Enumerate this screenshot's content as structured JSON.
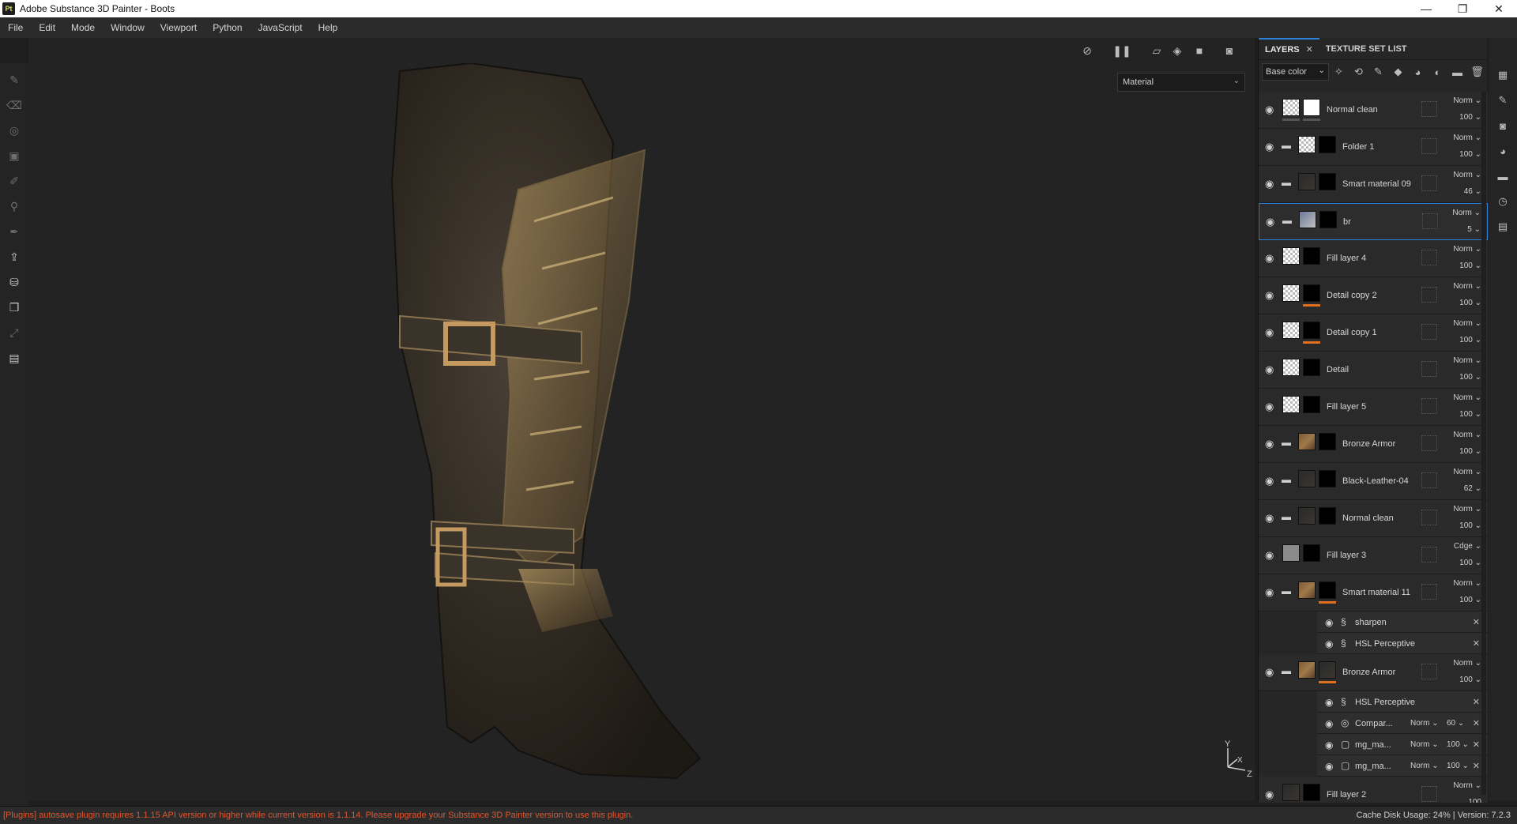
{
  "window": {
    "app_logo": "Pt",
    "title": "Adobe Substance 3D Painter - Boots",
    "controls": {
      "minimize": "—",
      "maximize": "❐",
      "close": "✕"
    }
  },
  "menu": [
    "File",
    "Edit",
    "Mode",
    "Window",
    "Viewport",
    "Python",
    "JavaScript",
    "Help"
  ],
  "viewport": {
    "material_mode": "Material",
    "axis": {
      "y": "Y",
      "x": "X",
      "z": "Z"
    }
  },
  "panel": {
    "tabs": [
      {
        "label": "LAYERS",
        "close": "✕"
      },
      {
        "label": "TEXTURE SET LIST"
      }
    ],
    "channel": "Base color",
    "layers": [
      {
        "name": "Normal clean",
        "blend": "Norm ⌄",
        "opacity": "100 ⌄"
      },
      {
        "name": "Folder 1",
        "blend": "Norm ⌄",
        "opacity": "100 ⌄"
      },
      {
        "name": "Smart material 09",
        "blend": "Norm ⌄",
        "opacity": "46 ⌄"
      },
      {
        "name": "br",
        "blend": "Norm ⌄",
        "opacity": "5 ⌄"
      },
      {
        "name": "Fill layer 4",
        "blend": "Norm ⌄",
        "opacity": "100 ⌄"
      },
      {
        "name": "Detail copy 2",
        "blend": "Norm ⌄",
        "opacity": "100 ⌄"
      },
      {
        "name": "Detail copy 1",
        "blend": "Norm ⌄",
        "opacity": "100 ⌄"
      },
      {
        "name": "Detail",
        "blend": "Norm ⌄",
        "opacity": "100 ⌄"
      },
      {
        "name": "Fill layer 5",
        "blend": "Norm ⌄",
        "opacity": "100 ⌄"
      },
      {
        "name": "Bronze Armor",
        "blend": "Norm ⌄",
        "opacity": "100 ⌄"
      },
      {
        "name": "Black-Leather-04",
        "blend": "Norm ⌄",
        "opacity": "62 ⌄"
      },
      {
        "name": "Normal clean",
        "blend": "Norm ⌄",
        "opacity": "100 ⌄"
      },
      {
        "name": "Fill layer 3",
        "blend": "Cdge ⌄",
        "opacity": "100 ⌄"
      },
      {
        "name": "Smart material 11",
        "blend": "Norm ⌄",
        "opacity": "100 ⌄"
      },
      {
        "name": "Bronze Armor",
        "blend": "Norm ⌄",
        "opacity": "100 ⌄"
      },
      {
        "name": "Fill layer 2",
        "blend": "Norm ⌄",
        "opacity": "100"
      }
    ],
    "effects_sm11": [
      {
        "name": "sharpen",
        "close": "✕"
      },
      {
        "name": "HSL Perceptive",
        "close": "✕"
      }
    ],
    "effects_bronze": [
      {
        "name": "HSL Perceptive",
        "blend": "",
        "opacity": "",
        "close": "✕"
      },
      {
        "name": "Compar...",
        "blend": "Norm ⌄",
        "opacity": "60 ⌄",
        "close": "✕"
      },
      {
        "name": "mg_ma...",
        "blend": "Norm ⌄",
        "opacity": "100 ⌄",
        "close": "✕"
      },
      {
        "name": "mg_ma...",
        "blend": "Norm ⌄",
        "opacity": "100 ⌄",
        "close": "✕"
      }
    ]
  },
  "status": {
    "message": "[Plugins] autosave plugin requires 1.1.15 API version or higher while current version is 1.1.14. Please upgrade your Substance 3D Painter version to use this plugin.",
    "right": "Cache Disk Usage:   24% | Version: 7.2.3"
  },
  "colors": {
    "accent": "#2a82da",
    "warning": "#e0562e",
    "mask_underline": "#e07020"
  }
}
